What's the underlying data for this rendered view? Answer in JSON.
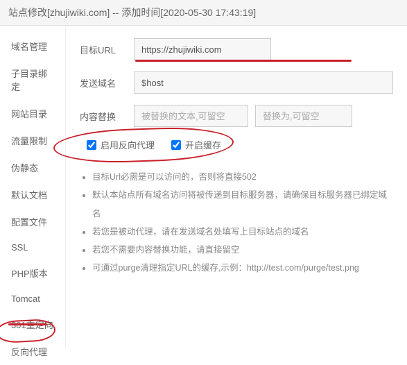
{
  "header": {
    "title": "站点修改[zhujiwiki.com] -- 添加时间[2020-05-30 17:43:19]"
  },
  "sidebar": {
    "items": [
      {
        "label": "域名管理"
      },
      {
        "label": "子目录绑定"
      },
      {
        "label": "网站目录"
      },
      {
        "label": "流量限制"
      },
      {
        "label": "伪静态"
      },
      {
        "label": "默认文档"
      },
      {
        "label": "配置文件"
      },
      {
        "label": "SSL"
      },
      {
        "label": "PHP版本"
      },
      {
        "label": "Tomcat"
      },
      {
        "label": "301重定向"
      },
      {
        "label": "反向代理"
      }
    ]
  },
  "form": {
    "target_url": {
      "label": "目标URL",
      "value": "https://zhujiwiki.com"
    },
    "send_domain": {
      "label": "发送域名",
      "value": "$host"
    },
    "content_replace": {
      "label": "内容替换",
      "placeholder1": "被替换的文本,可留空",
      "placeholder2": "替换为,可留空"
    },
    "checkboxes": {
      "enable_proxy": "启用反向代理",
      "enable_cache": "开启缓存"
    }
  },
  "notes": [
    "目标Url必需是可以访问的，否则将直接502",
    "默认本站点所有域名访问将被传递到目标服务器，请确保目标服务器已绑定域名",
    "若您是被动代理，请在发送域名处填写上目标站点的域名",
    "若您不需要内容替换功能，请直接留空",
    "可通过purge清理指定URL的缓存,示例：http://test.com/purge/test.png"
  ]
}
